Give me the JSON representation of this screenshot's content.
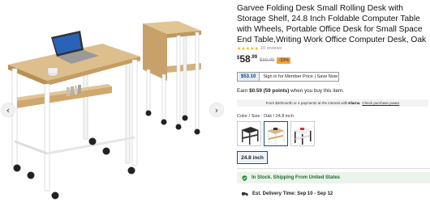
{
  "gallery": {
    "prev_arrow": "‹",
    "next_arrow": "›"
  },
  "product": {
    "title": "Garvee Folding Desk Small Rolling Desk with Storage Shelf, 24.8 Inch Foldable Computer Table with Wheels, Portable Office Desk for Small Space End Table,Writing Work Office Computer Desk, Oak",
    "stars": "★★★★★",
    "reviews": "10 reviews",
    "price_currency": "$",
    "price_whole": "58",
    "price_cents": ".99",
    "price_old": "$88.99",
    "discount": "-33%"
  },
  "member": {
    "price": "$53.10",
    "text": "Sign in for Member Price | Save Now"
  },
  "points": {
    "prefix": "Earn ",
    "bold": "$0.59 (59 points)",
    "suffix": " when you buy this item."
  },
  "finance": {
    "text": "From $20/month or 4 payments at 0% interest with",
    "brand": "Klarna",
    "link": "Check purchase power"
  },
  "options": {
    "color_label": "Color / Size : Oak / 24.8 inch",
    "size_label": "24.8 inch"
  },
  "stock": {
    "text": "In Stock. Shipping From United States"
  },
  "delivery": {
    "text": "Est. Delivery Time: Sep 10 - Sep 12"
  },
  "colors": {
    "oak": "#d9b985",
    "frame": "#ffffff",
    "brand_blue": "#1c4a8a",
    "discount": "#f4a23b",
    "stock_green": "#1d6b2b"
  }
}
